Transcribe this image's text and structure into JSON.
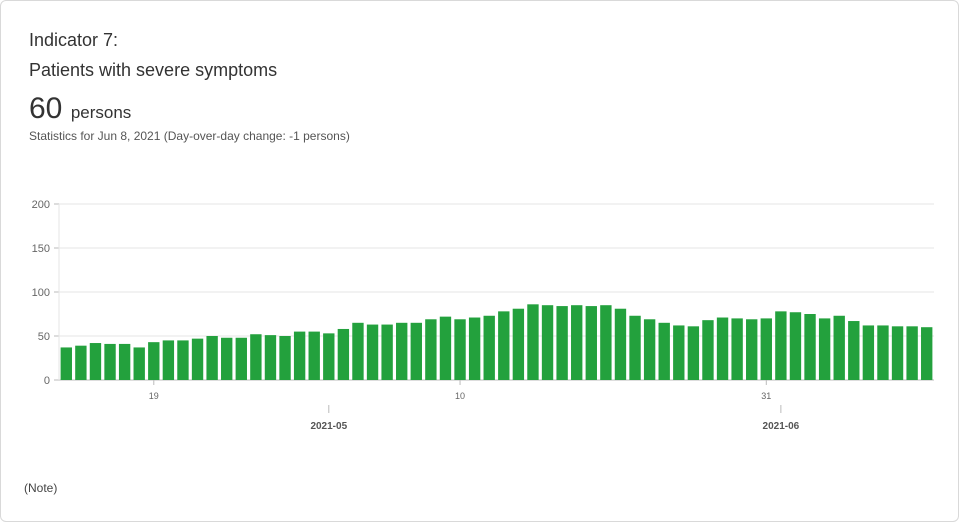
{
  "indicator": {
    "title_line1": "Indicator 7:",
    "title_line2": "Patients with severe symptoms",
    "value": "60",
    "unit": "persons",
    "stats_text": "Statistics for Jun 8, 2021  (Day-over-day change: -1 persons)"
  },
  "note": "(Note)",
  "colors": {
    "bar": "#23a13d",
    "grid": "#e6e6e6",
    "axis": "#bbbbbb"
  },
  "chart_data": {
    "type": "bar",
    "x": [
      "2021-04-13",
      "2021-04-14",
      "2021-04-15",
      "2021-04-16",
      "2021-04-17",
      "2021-04-18",
      "2021-04-19",
      "2021-04-20",
      "2021-04-21",
      "2021-04-22",
      "2021-04-23",
      "2021-04-24",
      "2021-04-25",
      "2021-04-26",
      "2021-04-27",
      "2021-04-28",
      "2021-04-29",
      "2021-04-30",
      "2021-05-01",
      "2021-05-02",
      "2021-05-03",
      "2021-05-04",
      "2021-05-05",
      "2021-05-06",
      "2021-05-07",
      "2021-05-08",
      "2021-05-09",
      "2021-05-10",
      "2021-05-11",
      "2021-05-12",
      "2021-05-13",
      "2021-05-14",
      "2021-05-15",
      "2021-05-16",
      "2021-05-17",
      "2021-05-18",
      "2021-05-19",
      "2021-05-20",
      "2021-05-21",
      "2021-05-22",
      "2021-05-23",
      "2021-05-24",
      "2021-05-25",
      "2021-05-26",
      "2021-05-27",
      "2021-05-28",
      "2021-05-29",
      "2021-05-30",
      "2021-05-31",
      "2021-06-01",
      "2021-06-02",
      "2021-06-03",
      "2021-06-04",
      "2021-06-05",
      "2021-06-06",
      "2021-06-07",
      "2021-06-08"
    ],
    "values": [
      37,
      39,
      42,
      41,
      41,
      37,
      43,
      45,
      45,
      47,
      50,
      48,
      48,
      52,
      51,
      50,
      55,
      55,
      53,
      58,
      65,
      63,
      63,
      65,
      65,
      69,
      72,
      69,
      71,
      73,
      78,
      81,
      86,
      85,
      84,
      85,
      84,
      85,
      81,
      73,
      69,
      65,
      62,
      61,
      68,
      71,
      70,
      69,
      70,
      78,
      77,
      75,
      70,
      73,
      67,
      62,
      62,
      61,
      61,
      60
    ],
    "title": "",
    "xlabel": "",
    "ylabel": "",
    "ylim": [
      0,
      200
    ],
    "yticks": [
      0,
      50,
      100,
      150,
      200
    ],
    "x_day_ticks": [
      {
        "label": "19",
        "index": 6
      },
      {
        "label": "10",
        "index": 27
      },
      {
        "label": "31",
        "index": 48
      }
    ],
    "x_month_ticks": [
      {
        "label": "2021-05",
        "index": 18
      },
      {
        "label": "2021-06",
        "index": 49
      }
    ],
    "grid": true
  }
}
